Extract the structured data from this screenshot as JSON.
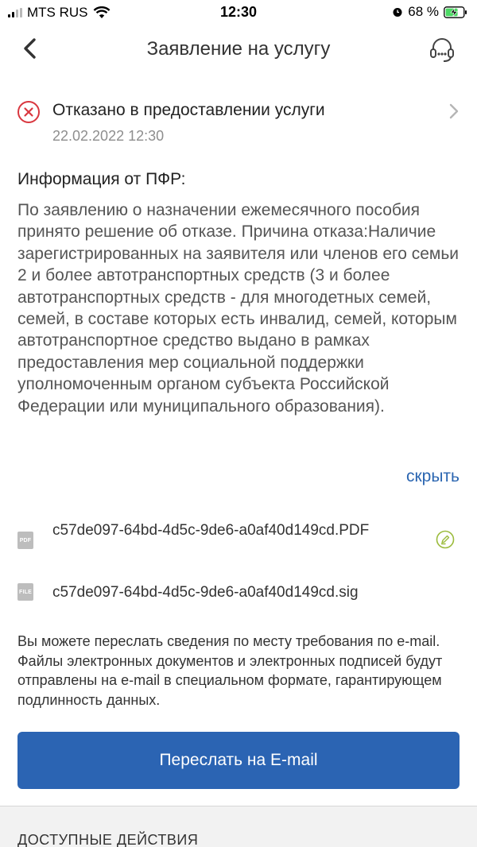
{
  "status_bar": {
    "carrier": "MTS RUS",
    "time": "12:30",
    "battery": "68 %"
  },
  "header": {
    "title": "Заявление на услугу"
  },
  "status": {
    "title": "Отказано в предоставлении услуги",
    "date": "22.02.2022 12:30",
    "color": "#d9373f"
  },
  "info": {
    "heading": "Информация от ПФР:",
    "body": "По заявлению о назначении ежемесячного пособия принято решение об отказе. Причина отказа:Наличие зарегистрированных на заявителя или членов его семьи 2 и более автотранспортных средств (3 и более автотранспортных средств - для многодетных семей, семей, в составе которых есть инвалид, семей, которым автотранспортное средство выдано в рамках предоставления мер социальной поддержки уполномоченным органом субъекта Российской Федерации или муниципального образования).",
    "hide_label": "скрыть"
  },
  "files": [
    {
      "type_label": "PDF",
      "name": "c57de097-64bd-4d5c-9de6-a0af40d149cd.PDF"
    },
    {
      "type_label": "FILE",
      "name": "c57de097-64bd-4d5c-9de6-a0af40d149cd.sig"
    }
  ],
  "note": "Вы можете переслать сведения по месту требования по e-mail. Файлы электронных документов и электронных подписей будут отправлены на e-mail в специальном формате, гарантирующем  подлинность данных.",
  "email_button_label": "Переслать на E-mail",
  "actions": {
    "heading": "ДОСТУПНЫЕ ДЕЙСТВИЯ"
  },
  "icons": {
    "back": "chevron-left-icon",
    "support": "headset-icon",
    "status": "error-x-icon",
    "chevron": "chevron-right-icon",
    "sign": "signature-icon"
  },
  "colors": {
    "accent": "#2b64b3",
    "link": "#2b66b1",
    "error": "#d9373f",
    "sign": "#9bbb3c"
  }
}
